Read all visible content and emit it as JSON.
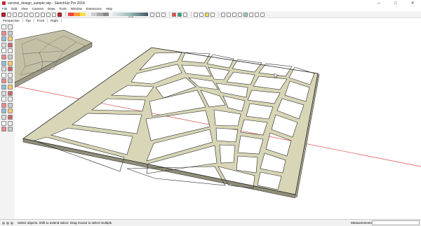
{
  "window": {
    "title": "voronoi_design_sample.skp - SketchUp Pro 2018",
    "minimize_glyph": "─",
    "maximize_glyph": "□",
    "close_glyph": "✕"
  },
  "menu": {
    "items": [
      "File",
      "Edit",
      "View",
      "Camera",
      "Draw",
      "Tools",
      "Window",
      "Extensions",
      "Help"
    ]
  },
  "toolbar": {
    "gradient_label": "Level"
  },
  "scene_tabs": [
    "Perspective",
    "Top",
    "Front",
    "Right"
  ],
  "status": {
    "message": "Select objects. Shift to extend select. Drag mouse to select multiple.",
    "measurements_label": "Measurements",
    "measurements_value": ""
  },
  "colors": {
    "frame_face": "#d8d6b6",
    "frame_edge": "#262626",
    "red_axis": "#d94a4a",
    "panel_top": "#c4c0a6",
    "panel_side": "#9d9a86"
  },
  "icons": {
    "left_tools": [
      "select-icon",
      "component-icon",
      "eraser-icon",
      "paint-icon",
      "line-icon",
      "freehand-icon",
      "rectangle-icon",
      "rotated-rect-icon",
      "circle-icon",
      "polygon-icon",
      "arc-icon",
      "pie-icon",
      "pushpull-icon",
      "followme-icon",
      "move-icon",
      "rotate-icon",
      "scale-icon",
      "offset-icon",
      "tape-icon",
      "dimension-icon",
      "protractor-icon",
      "text-icon",
      "axes-icon",
      "3dtext-icon",
      "orbit-icon",
      "pan-icon",
      "zoom-icon",
      "zoom-window-icon",
      "zoom-extents-icon",
      "previous-icon",
      "position-camera-icon",
      "walk-icon",
      "look-around-icon",
      "section-icon",
      "warehouse-icon",
      "extension-icon"
    ]
  }
}
